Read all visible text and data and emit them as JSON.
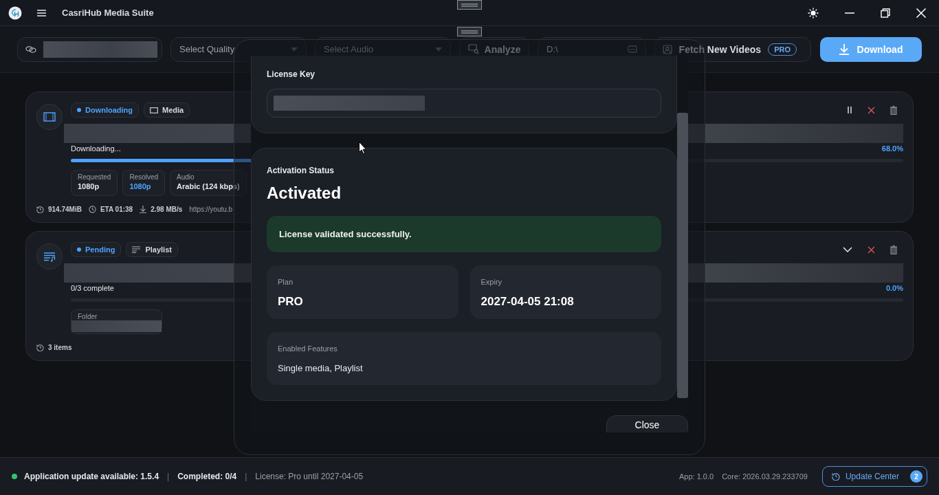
{
  "titlebar": {
    "title": "CasriHub Media Suite"
  },
  "toolbar": {
    "quality": {
      "placeholder": "Select Quality"
    },
    "audio": {
      "placeholder": "Select Audio"
    },
    "analyze": "Analyze",
    "path": {
      "value": "D:\\"
    },
    "fetch": {
      "label": "Fetch New Videos",
      "badge": "PRO"
    },
    "download": "Download"
  },
  "downloads": [
    {
      "kind": "media",
      "status": "Downloading",
      "type_tag": "Media",
      "state_text": "Downloading...",
      "percent": "68.0%",
      "level": 0.68,
      "chips": [
        {
          "kind": "text",
          "label": "Requested",
          "value": "1080p",
          "highlight": false
        },
        {
          "kind": "text",
          "label": "Resolved",
          "value": "1080p",
          "highlight": true
        },
        {
          "kind": "text",
          "label": "Audio",
          "value": "Arabic (124 kbps)",
          "highlight": false
        }
      ],
      "stats": [
        {
          "kind": "size",
          "text": "914.74MiB"
        },
        {
          "kind": "eta",
          "text": "ETA 01:38"
        },
        {
          "kind": "speed",
          "text": "2.98 MB/s"
        },
        {
          "kind": "url",
          "text": "https://youtu.b"
        }
      ]
    },
    {
      "kind": "playlist",
      "status": "Pending",
      "type_tag": "Playlist",
      "state_text": "0/3 complete",
      "percent": "0.0%",
      "level": 0,
      "chips": [
        {
          "kind": "redacted",
          "label": "Folder"
        }
      ],
      "stats": [
        {
          "kind": "size",
          "text": "3 items"
        }
      ]
    }
  ],
  "dialog": {
    "license_key": {
      "label": "License Key"
    },
    "activation": {
      "label": "Activation Status",
      "status": "Activated",
      "message": "License validated successfully.",
      "plan": {
        "label": "Plan",
        "value": "PRO"
      },
      "expiry": {
        "label": "Expiry",
        "value": "2027-04-05 21:08"
      },
      "features": {
        "label": "Enabled Features",
        "value": "Single media, Playlist"
      }
    },
    "close": "Close"
  },
  "status_bar": {
    "items": [
      {
        "kind": "update",
        "text": "Application update available: 1.5.4"
      },
      {
        "kind": "separator",
        "text": "|"
      },
      {
        "kind": "bold",
        "text": "Completed: 0/4"
      },
      {
        "kind": "separator",
        "text": "|"
      },
      {
        "kind": "muted",
        "text": "License: Pro until 2027-04-05"
      }
    ],
    "app_version": "App: 1.0.0",
    "core_version": "Core: 2026.03.29.233709",
    "update_center": {
      "label": "Update Center",
      "count": "2"
    }
  }
}
